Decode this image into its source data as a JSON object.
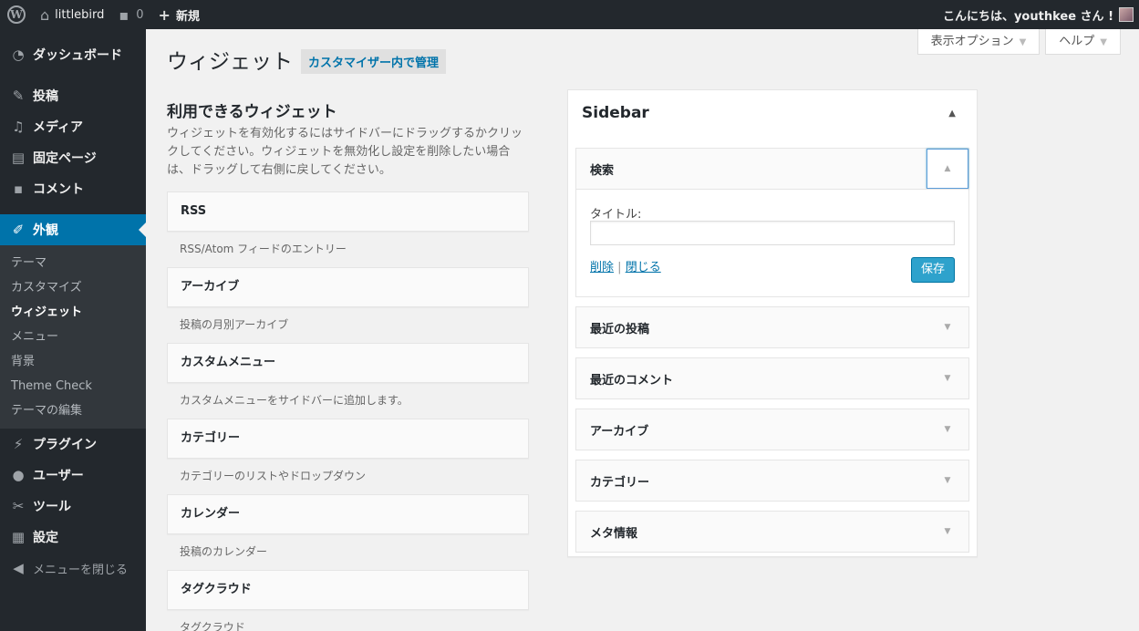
{
  "adminbar": {
    "site_name": "littlebird",
    "comment_count": "0",
    "new_label": "新規",
    "greeting": "こんにちは、youthkee さん !"
  },
  "menu": {
    "dashboard": "ダッシュボード",
    "posts": "投稿",
    "media": "メディア",
    "pages": "固定ページ",
    "comments": "コメント",
    "appearance": "外観",
    "submenu": {
      "themes": "テーマ",
      "customize": "カスタマイズ",
      "widgets": "ウィジェット",
      "menus": "メニュー",
      "background": "背景",
      "theme_check": "Theme Check",
      "editor": "テーマの編集"
    },
    "plugins": "プラグイン",
    "users": "ユーザー",
    "tools": "ツール",
    "settings": "設定",
    "collapse": "メニューを閉じる"
  },
  "screen_meta": {
    "screen_options": "表示オプション",
    "help": "ヘルプ"
  },
  "page": {
    "title": "ウィジェット",
    "action": "カスタマイザー内で管理"
  },
  "available": {
    "title": "利用できるウィジェット",
    "description": "ウィジェットを有効化するにはサイドバーにドラッグするかクリックしてください。ウィジェットを無効化し設定を削除したい場合は、ドラッグして右側に戻してください。",
    "widgets": [
      {
        "name": "RSS",
        "desc": "RSS/Atom フィードのエントリー"
      },
      {
        "name": "アーカイブ",
        "desc": "投稿の月別アーカイブ"
      },
      {
        "name": "カスタムメニュー",
        "desc": "カスタムメニューをサイドバーに追加します。"
      },
      {
        "name": "カテゴリー",
        "desc": "カテゴリーのリストやドロップダウン"
      },
      {
        "name": "カレンダー",
        "desc": "投稿のカレンダー"
      },
      {
        "name": "タグクラウド",
        "desc": "タグクラウド"
      }
    ]
  },
  "sidebar": {
    "title": "Sidebar",
    "open_widget": {
      "name": "検索",
      "field_label": "タイトル:",
      "field_value": "",
      "delete_link": "削除",
      "separator": "|",
      "close_link": "閉じる",
      "save_label": "保存"
    },
    "widgets": [
      "最近の投稿",
      "最近のコメント",
      "アーカイブ",
      "カテゴリー",
      "メタ情報"
    ]
  },
  "colors": {
    "accent": "#0073aa",
    "admin_bar": "#23282d",
    "button": "#2ea2cc"
  }
}
